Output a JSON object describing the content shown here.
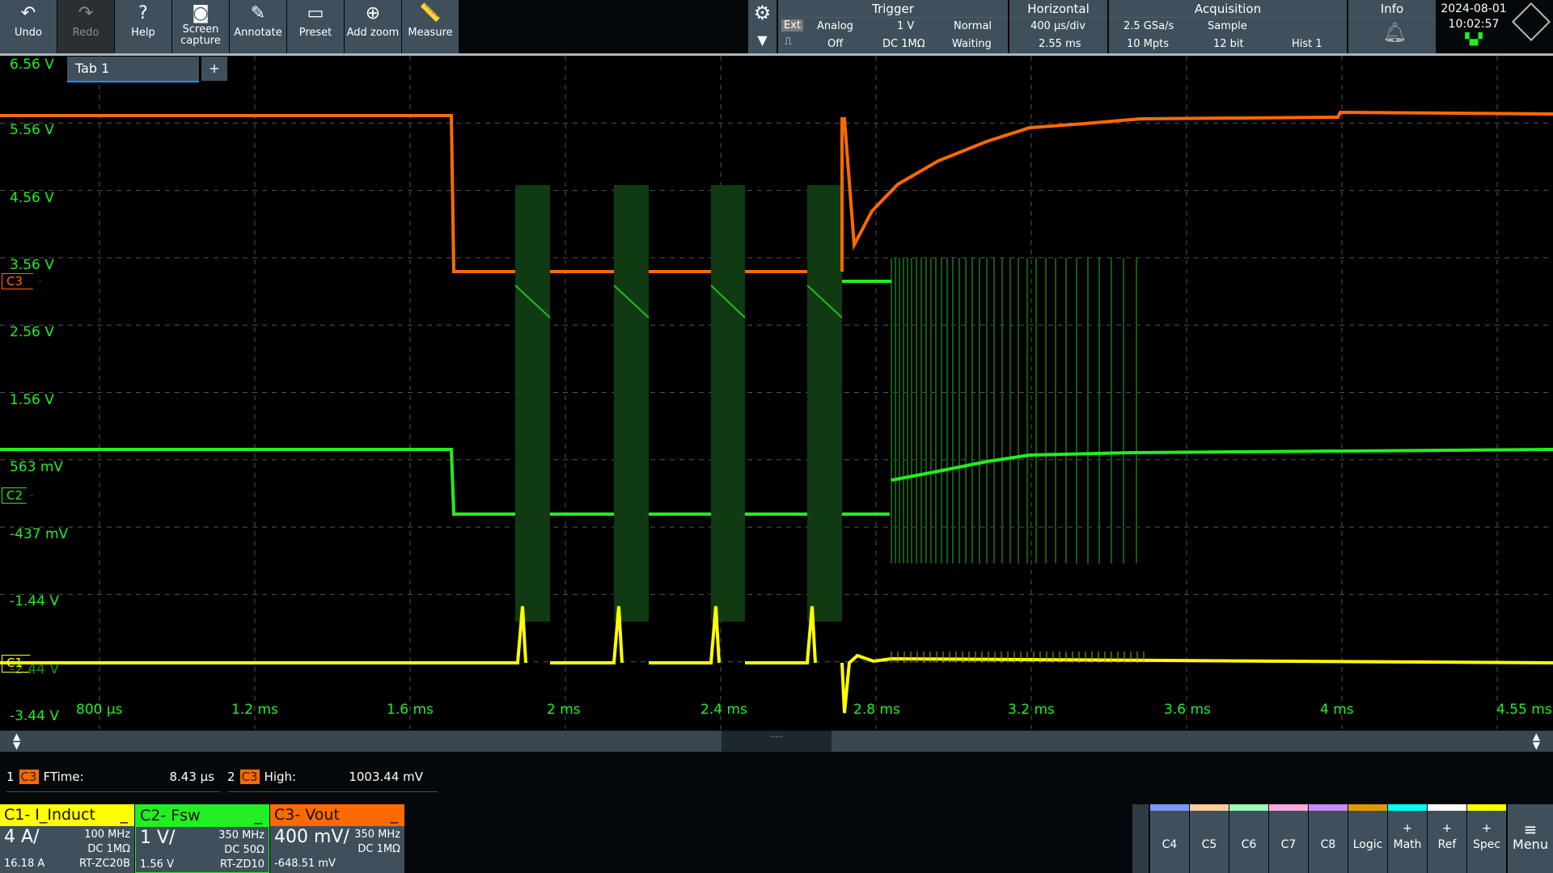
{
  "toolbar": {
    "buttons": [
      {
        "label": "Undo",
        "icon": "undo-icon",
        "glyph": "↶"
      },
      {
        "label": "Redo",
        "icon": "redo-icon",
        "glyph": "↷"
      },
      {
        "label": "Help",
        "icon": "help-icon",
        "glyph": "?"
      },
      {
        "label": "Screen capture",
        "icon": "camera-icon",
        "glyph": "◙"
      },
      {
        "label": "Annotate",
        "icon": "pencil-icon",
        "glyph": "✎"
      },
      {
        "label": "Preset",
        "icon": "preset-icon",
        "glyph": "▭"
      },
      {
        "label": "Add zoom",
        "icon": "zoom-in-icon",
        "glyph": "⊕"
      },
      {
        "label": "Measure",
        "icon": "ruler-icon",
        "glyph": "📏"
      }
    ]
  },
  "trigger": {
    "title": "Trigger",
    "source": "Ext",
    "type": "Analog",
    "level": "1 V",
    "mode": "Normal",
    "coupling_state": "Off",
    "coupling": "DC 1MΩ",
    "status": "Waiting"
  },
  "horizontal": {
    "title": "Horizontal",
    "scale": "400 µs/div",
    "position": "2.55 ms"
  },
  "acquisition": {
    "title": "Acquisition",
    "rate": "2.5 GSa/s",
    "mode": "Sample",
    "points": "10 Mpts",
    "resolution": "12 bit",
    "hist": "Hist 1"
  },
  "info": {
    "title": "Info",
    "date": "2024-08-01",
    "time": "10:02:57"
  },
  "tab": {
    "label": "Tab 1",
    "add": "+"
  },
  "y_labels": [
    "6.56 V",
    "5.56 V",
    "4.56 V",
    "3.56 V",
    "2.56 V",
    "1.56 V",
    "563 mV",
    "-437 mV",
    "-1.44 V",
    "-2.44 V",
    "-3.44 V"
  ],
  "x_labels": [
    "800 µs",
    "1.2 ms",
    "1.6 ms",
    "2 ms",
    "2.4 ms",
    "2.8 ms",
    "3.2 ms",
    "3.6 ms",
    "4 ms",
    "4.55 ms"
  ],
  "markers": {
    "c1": "C1",
    "c2": "C2",
    "c3": "C3"
  },
  "measurements": [
    {
      "index": "1",
      "source": "C3",
      "name": "FTime:",
      "value": "8.43 µs"
    },
    {
      "index": "2",
      "source": "C3",
      "name": "High:",
      "value": "1003.44 mV"
    }
  ],
  "channels": [
    {
      "title": "C1- I_Induct",
      "scale": "4 A/",
      "bw": "100 MHz",
      "coupling": "DC 1MΩ",
      "offset": "16.18 A",
      "probe": "RT-ZC20B",
      "color": "#ffff00"
    },
    {
      "title": "C2- Fsw",
      "scale": "1 V/",
      "bw": "350 MHz",
      "coupling": "DC 50Ω",
      "offset": "1.56 V",
      "probe": "RT-ZD10",
      "color": "#22ee22"
    },
    {
      "title": "C3- Vout",
      "scale": "400 mV/",
      "bw": "350 MHz",
      "coupling": "DC 1MΩ",
      "offset": "-648.51 mV",
      "probe": "",
      "color": "#ff6a00"
    }
  ],
  "right_buttons": [
    {
      "label": "C4",
      "plus": "",
      "color": "#7799ff"
    },
    {
      "label": "C5",
      "plus": "",
      "color": "#ffcc99"
    },
    {
      "label": "C6",
      "plus": "",
      "color": "#99ffbb"
    },
    {
      "label": "C7",
      "plus": "",
      "color": "#ffaadd"
    },
    {
      "label": "C8",
      "plus": "",
      "color": "#cc88ff"
    },
    {
      "label": "Logic",
      "plus": "",
      "color": "#dd9900"
    },
    {
      "label": "Math",
      "plus": "+",
      "color": "#00ffff"
    },
    {
      "label": "Ref",
      "plus": "+",
      "color": "#ffffff"
    },
    {
      "label": "Spec",
      "plus": "+",
      "color": "#ffff00"
    }
  ],
  "menu": {
    "label": "Menu"
  }
}
